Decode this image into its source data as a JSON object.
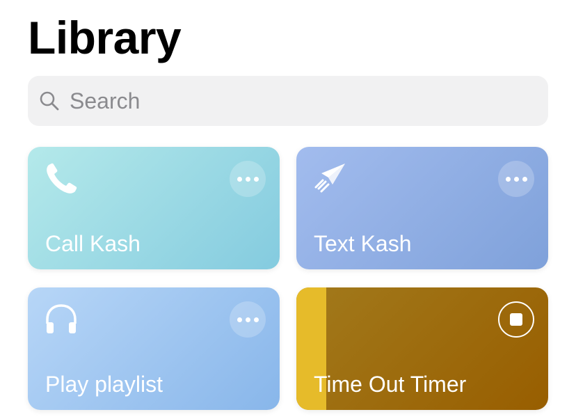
{
  "header": {
    "title": "Library"
  },
  "search": {
    "placeholder": "Search",
    "value": ""
  },
  "shortcuts": [
    {
      "label": "Call Kash",
      "icon": "phone-icon",
      "action_icon": "more-icon",
      "color": "#84cbdf"
    },
    {
      "label": "Text Kash",
      "icon": "paper-plane-icon",
      "action_icon": "more-icon",
      "color": "#7fa1da"
    },
    {
      "label": "Play playlist",
      "icon": "headphones-icon",
      "action_icon": "more-icon",
      "color": "#88b6ea"
    },
    {
      "label": "Time Out Timer",
      "icon": "",
      "action_icon": "stop-icon",
      "color": "#985e00",
      "progress": 0.12
    }
  ]
}
